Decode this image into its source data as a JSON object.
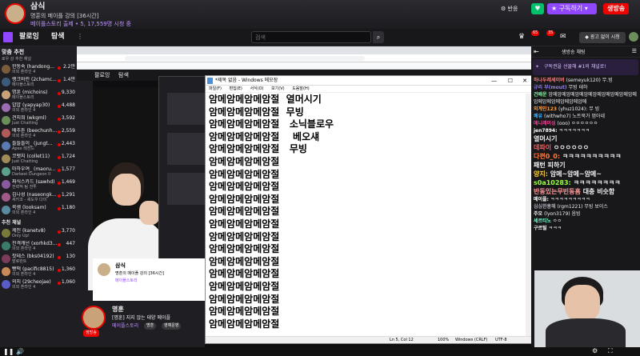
{
  "header": {
    "streamer_name": "삼식",
    "stream_title": "명훈의 메이플 강의 [36시간]",
    "category_line": "메이플스토리 출제 • 5, 17,559명 시청 중",
    "notice_label": "반응",
    "subscribe_label": "구독하기",
    "live_label": "생방송"
  },
  "nav": {
    "follow": "팔로잉",
    "explore": "탐색",
    "search_placeholder": "검색",
    "badge1": "65",
    "badge2": "35",
    "ad_free": "광고 없이 시청"
  },
  "sidebar": {
    "title": "맞춤 추천",
    "subtitle": "로우 강 추천 채널",
    "channels": [
      {
        "name": "한동숙 (handong...",
        "game": "의외 혼라인 4",
        "viewers": "2.2만",
        "color": "#7a5c3c"
      },
      {
        "name": "랭크바린 (2chamc...",
        "game": "메이플스토리",
        "viewers": "1.4만",
        "color": "#3c5a7a"
      },
      {
        "name": "명훈 (michoins)",
        "game": "메이플스토리",
        "viewers": "9,330",
        "color": "#c9a27a"
      },
      {
        "name": "얍얍 (yapyap30)",
        "game": "의외 혼라인 4",
        "viewers": "4,488",
        "color": "#9a6cb0"
      },
      {
        "name": "견지희 (wkgml)",
        "game": "Just Chatting",
        "viewers": "3,592",
        "color": "#6b8e5a"
      },
      {
        "name": "배추튼 (beechunh...",
        "game": "의외 혼라인 4",
        "viewers": "2,559",
        "color": "#b05a5a"
      },
      {
        "name": "들들들이_ (jungt...",
        "game": "Apex 레전드",
        "viewers": "2,443",
        "color": "#5a7ab0"
      },
      {
        "name": "코렛지 (collet11)",
        "game": "Just Chatting",
        "viewers": "1,724",
        "color": "#a08a5a"
      },
      {
        "name": "마하우여_ (maoru...",
        "game": "Darkest Dungeon II",
        "viewers": "1,577",
        "color": "#5aa08a"
      },
      {
        "name": "짜식스카드 (sawhd)",
        "game": "전략적 팀 전투",
        "viewers": "1,469",
        "color": "#8a5aa0"
      },
      {
        "name": "김나성 (naseongk...",
        "game": "새키코 - 셰도우 다이",
        "viewers": "1,291",
        "color": "#a05a8a"
      },
      {
        "name": "룩셈 (looksam)",
        "game": "의외 혼라인 4",
        "viewers": "1,180",
        "color": "#5a8aa0"
      }
    ],
    "section2_title": "추천 채널",
    "channels2": [
      {
        "name": "케인 (kanetv8)",
        "game": "Only Up!",
        "viewers": "3,770",
        "color": "#7a7a3c"
      },
      {
        "name": "진격캐넌 (xorhkd3...",
        "game": "의외 혼라인 4",
        "viewers": "447",
        "color": "#3c7a6a"
      },
      {
        "name": "잣테스 (bks04192)",
        "game": "발로란트",
        "viewers": "130",
        "color": "#7a3c5a"
      },
      {
        "name": "빵떡 (pacific8815)",
        "game": "의외 혼라인 4",
        "viewers": "1,360",
        "color": "#c98a5a"
      },
      {
        "name": "의지 (29cheojae)",
        "game": "의외 혼라인 4",
        "viewers": "1,060",
        "color": "#5a5ac9"
      }
    ]
  },
  "chat": {
    "title": "생방송 채팅",
    "sub_banner": "구독권을 선물해 #1의 채널로!",
    "lines": [
      {
        "user": "하나두레세이버",
        "user_color": "#ff7a7a",
        "text": "(semeyuk120) 무.빙"
      },
      {
        "user": "규리 부(mout)",
        "user_color": "#9a7aff",
        "text": "무빙 테하"
      },
      {
        "user": "건배운",
        "user_color": "#7aff9a",
        "text": "암메암메암메암메암메암메암메암메암메암메암메암메암메암메암메암메"
      },
      {
        "user": "외계인123",
        "user_color": "#ff9a3c",
        "text": "(yhuz1024): 무 빙"
      },
      {
        "user": "쾌유",
        "user_color": "#3cb0ff",
        "text": "(withwho7) 노트북가 멈아네"
      },
      {
        "user": "애니레이싱",
        "user_color": "#ff3c9a",
        "text": "(ooo) ㅇㅇㅇㅇㅇㅇ"
      },
      {
        "user": "jen7894:",
        "user_color": "#ffffff",
        "text": "ㅋㅋㅋㅋㅋㅋㅋ"
      },
      {
        "user": "",
        "user_color": "#ffffff",
        "text": "열머시기"
      },
      {
        "user": "데파이",
        "user_color": "#ff5a5a",
        "text": "ㅇㅇㅇㅇㅇㅇ"
      },
      {
        "user": "다편0_0:",
        "user_color": "#ff7a3c",
        "text": "ㅋㅋㅋㅋㅋㅋㅋㅋㅋㅋ"
      },
      {
        "user": "",
        "user_color": "#ffffff",
        "text": "패턴 피하기"
      },
      {
        "user": "양지:",
        "user_color": "#ffd23c",
        "text": "암메~암메~암메~"
      },
      {
        "user": "s0a10283:",
        "user_color": "#9aff3c",
        "text": "ㅋㅋㅋㅋㅋㅋㅋㅋ"
      },
      {
        "user": "반동있는무빈동흠",
        "user_color": "#ff9a9a",
        "text": "대충 비슷함"
      },
      {
        "user": "메이플:",
        "user_color": "#ffffff",
        "text": "ㅋㅋㅋㅋㅋㅋㅋㅋㅋ"
      },
      {
        "user": "심심한홍해",
        "user_color": "#adadb8",
        "text": "(rgm1221) 무빙 보이스"
      },
      {
        "user": "주오",
        "user_color": "#ffffff",
        "text": "(lyon3179) 음빙"
      },
      {
        "user": "세르티노",
        "user_color": "#7affd2",
        "text": "ㅇㅇ"
      },
      {
        "user": "구르틸",
        "user_color": "#ffffff",
        "text": "ㅋㅋㅋ"
      }
    ]
  },
  "notepad": {
    "title": "*제목 없음 - Windows 메모장",
    "menu": [
      "파일(F)",
      "편집(E)",
      "서식(O)",
      "보기(V)",
      "도움말(H)"
    ],
    "lines": [
      "암메암메암메암절  열머시기",
      "암메암메암메암절  무빙",
      "암메암메암메암절   소닉블로우",
      "암메암메암메암절    베오섀",
      "암메암메암메암절   무빙",
      "암메암메암메암절",
      "암메암메암메암절",
      "암메암메암메암절",
      "암메암메암메암절",
      "암메암메암메암절",
      "암메암메암메암절",
      "암메암메암메암절",
      "암메암메암메암절",
      "암메암메암메암절",
      "암메암메암메암절",
      "암메암메암메암절",
      "암메암메암메암절",
      "암메암메암메암절",
      "암메암메암메암절"
    ],
    "status_pos": "Ln 5, Col 12",
    "status_zoom": "100%",
    "status_eol": "Windows (CRLF)",
    "status_enc": "UTF-8"
  },
  "inner_stream": {
    "follow": "팔로잉",
    "explore": "탐색",
    "name": "삼식",
    "title": "명훈의 메이플 강의 [36시간]",
    "game": "메이플스토리"
  },
  "bottom_card": {
    "name": "명훈",
    "title": "[명훈] 지지 않는 태양 메이플",
    "game": "메이플스토리",
    "tags": [
      "명훈",
      "영예운영"
    ],
    "live_label": "생방송"
  }
}
